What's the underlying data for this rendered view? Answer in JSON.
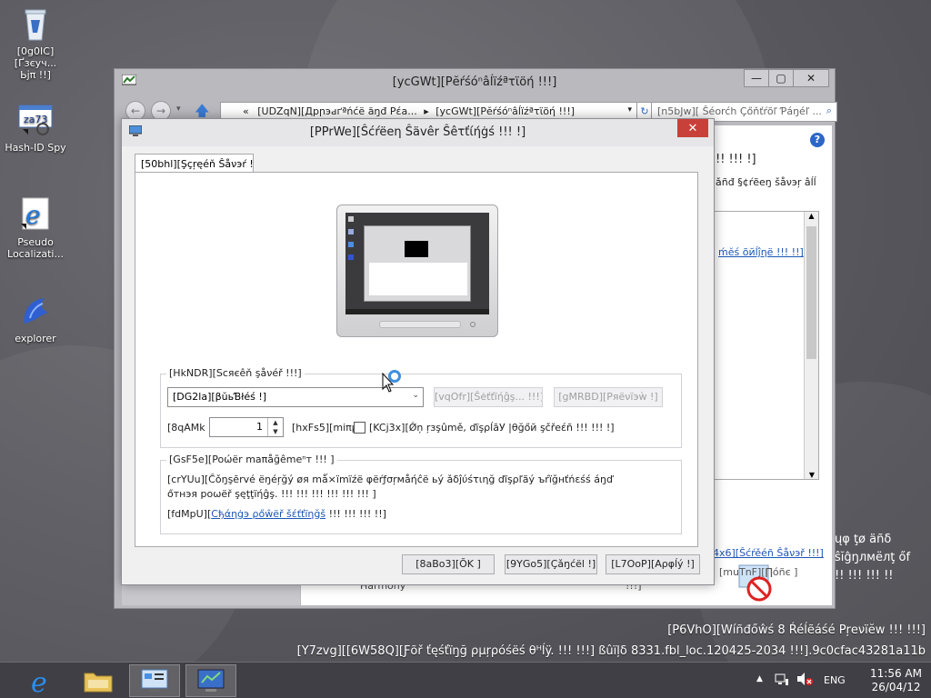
{
  "desktop": {
    "icons": [
      {
        "label": "[0g0IC][Ґзєуч...\nЬјπ !!]",
        "icon": "recycle-bin-icon"
      },
      {
        "label": "Hash-ID Spy",
        "icon": "hash-id-spy-icon"
      },
      {
        "label": "Pseudo Localizati...",
        "icon": "internet-explorer-shortcut-icon"
      },
      {
        "label": "explorer",
        "icon": "explorer-icon"
      }
    ],
    "watermark": {
      "line1": "[P6VhO][Wíñđőŵś 8 Ŕéĺẽáśé Ρŗeνïĕw !!! !!!]",
      "line2": "[Y7zvg][[6W58Q][Ƒõř ťęśťïŋğ ρμŗρόśëś θᴴĺÿ. !!! !!!] ßûïļδ 8331.fbl_loc.120425-2034 !!!].9c0cfac43281a11b"
    }
  },
  "bg_window": {
    "title": "[ycGWt][Pĕŕśóⁿâĺïźªτϊöή !!!]",
    "breadcrumb": {
      "prefix": "«",
      "crumb1": "[UDZqN][Дрրэԁґªńćё ăŋđ Ρέа...",
      "sep": "▸",
      "crumb2": "[ycGWt][Pĕŕśóⁿâĺïźªτϊöή !!!]"
    },
    "search_placeholder": "[n5bJw][ Ŝéorćh Çőňťŕõľ Ƥáŋéľ ...",
    "content": {
      "heading_tail": "!! !!! !]",
      "line_tail": "ǎñđ §¢ŕẽеŋ šåνэŗ âĺĺ",
      "link_tail": "ḿĕś õйĺĵηё !!! !!]",
      "bottom1": "ųφ ţø äñδ",
      "bottom2": "ŝĭĝŋлмёлţ őf",
      "bottom3": "!! !!! !!! !!",
      "screen_saver_link": "4x6][Ŝćŕěéñ Ŝåνэř !!!]",
      "none_label": "[muTnF][∏óñє ]",
      "harmony": "Harmony",
      "harmony_tail": "!!!]"
    }
  },
  "dialog": {
    "title": "[PPrWe][Ŝćŕëeη Ŝävêr Ŝêτťίήġś !!! !]",
    "tab": "[50bhl][Şçŗęéň Ŝåνэŕ !!!]",
    "screen_saver_group": "[HkNDR][Ѕсяєêň şåνéř !!!]",
    "combo_value": "[DG2la][βŭьƁłéś !]",
    "settings_button": "[vqOfr][Šėťťïήĝş... !!!]",
    "preview_button": "[gMRBD][Ρяёνïэẁ !]",
    "wait_label": "[8qAMk",
    "wait_value": "1",
    "minutes_label": "[hxFs5][miπμ",
    "resume_label": "[KCj3x][Ǿņ ŗзşûmě, ďïşρĺāУ |θğőй şčřеέñ !!! !!! !]",
    "power_group": "[GsF5e][Poώёr maπåğêmeⁿт !!! ]",
    "power_text1": "[crYUu][Ĉǒŋşērvé ёŋéŗğý øя mǻ×ïmïźё φёŕƒσŗмåήĉё ьý ǎδĵύśτιηğ ďïşρľãý ъŕïğнťńεśś áŋď",
    "power_text2": "őтнэя роωёř şęţţïήĝş. !!! !!! !!! !!! !!! !!! ]",
    "power_link_prefix": "[fdMpU][",
    "power_link": "Cђάηġэ ρőŵёř šέťťïηğš",
    "power_link_suffix": " !!! !!! !!! !!]",
    "ok": "[8aBo3][ŎK ]",
    "cancel": "[9YGo5][Çǎŋćёl !]",
    "apply": "[L7OoP][Αρφĺý !]"
  },
  "taskbar": {
    "language": "ENG",
    "time": "11:56 AM",
    "date": "26/04/12"
  },
  "colors": {
    "close_red": "#c7413a",
    "link_blue": "#1c56b6"
  }
}
